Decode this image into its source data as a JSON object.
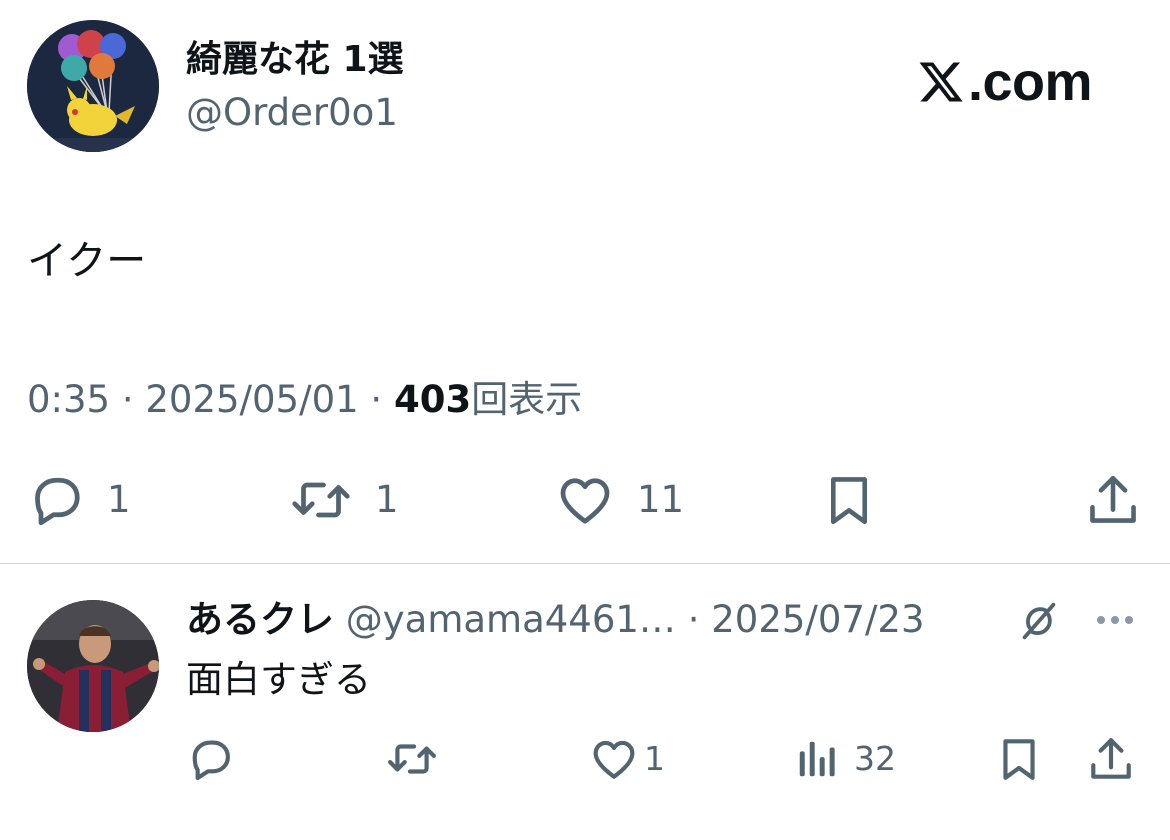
{
  "tweet": {
    "author": {
      "display_name": "綺麗な花 1選",
      "handle": "@Order0o1"
    },
    "brand": {
      "name": "X",
      "suffix": ".com"
    },
    "text": "イクー",
    "time": "0:35",
    "sep1": " · ",
    "date": "2025/05/01",
    "sep2": " · ",
    "views_count": "403",
    "views_label": "回表示",
    "actions": {
      "reply_count": "1",
      "retweet_count": "1",
      "like_count": "11"
    }
  },
  "reply": {
    "author": {
      "display_name": "あるクレ",
      "handle": "@yamama4461…"
    },
    "sep": " · ",
    "date": "2025/07/23",
    "text": "面白すぎる",
    "actions": {
      "like_count": "1",
      "views_count": "32"
    }
  },
  "colors": {
    "text_primary": "#0f1419",
    "text_secondary": "#536471",
    "divider": "#cfd9de"
  },
  "icons": {
    "reply": "speech-bubble-icon",
    "retweet": "retweet-arrows-icon",
    "like": "heart-icon",
    "bookmark": "bookmark-icon",
    "share": "share-upload-icon",
    "views": "bar-chart-icon",
    "grok": "grok-icon",
    "more": "more-dots-icon"
  }
}
